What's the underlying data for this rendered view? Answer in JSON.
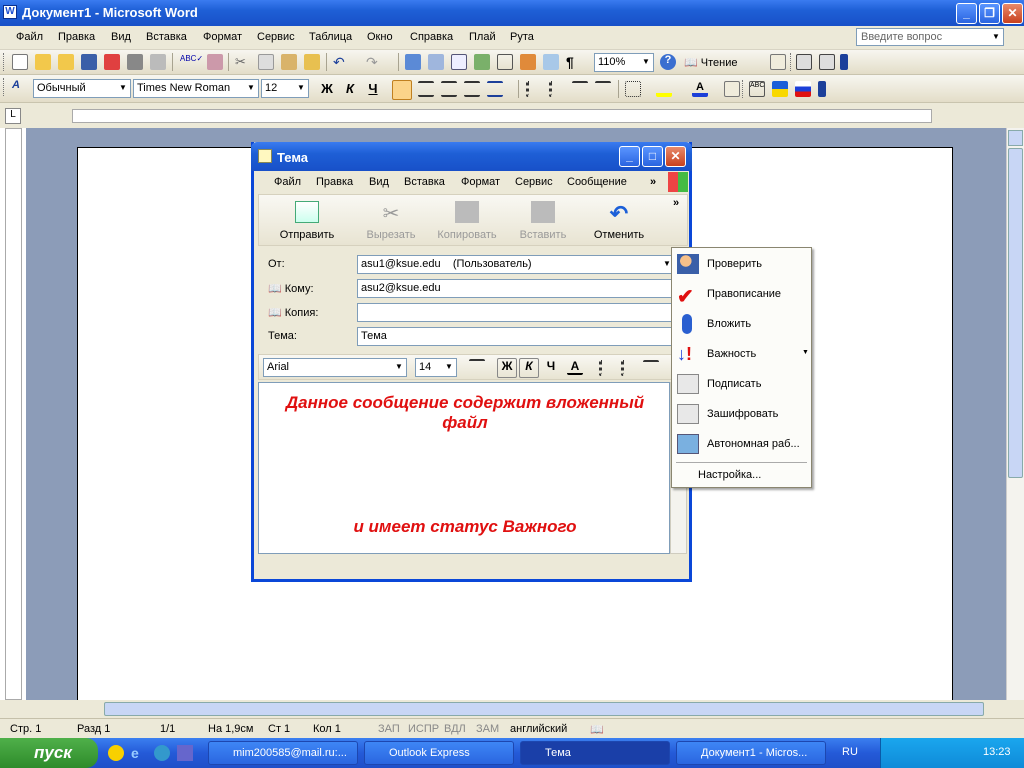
{
  "word": {
    "title": "Документ1 - Microsoft Word",
    "menu": [
      "Файл",
      "Правка",
      "Вид",
      "Вставка",
      "Формат",
      "Сервис",
      "Таблица",
      "Окно",
      "Справка",
      "Плай",
      "Рута"
    ],
    "help_placeholder": "Введите вопрос",
    "zoom": "110%",
    "read_label": "Чтение",
    "style": "Обычный",
    "font": "Times New Roman",
    "size": "12",
    "bold": "Ж",
    "italic": "К",
    "underline": "Ч"
  },
  "status": {
    "page": "Стр. 1",
    "section": "Разд 1",
    "pages": "1/1",
    "pos": "На 1,9см",
    "line": "Ст 1",
    "col": "Кол 1",
    "rec": "ЗАП",
    "trk": "ИСПР",
    "ext": "ВДЛ",
    "ovr": "ЗАМ",
    "lang": "английский"
  },
  "taskbar": {
    "start": "пуск",
    "tasks": [
      "mim200585@mail.ru:...",
      "Outlook Express",
      "Тема",
      "Документ1 - Micros..."
    ],
    "lang": "RU",
    "clock": "13:23"
  },
  "oe": {
    "title": "Тема",
    "menu": [
      "Файл",
      "Правка",
      "Вид",
      "Вставка",
      "Формат",
      "Сервис",
      "Сообщение"
    ],
    "tools": [
      "Отправить",
      "Вырезать",
      "Копировать",
      "Вставить",
      "Отменить"
    ],
    "from_label": "От:",
    "from_value": "asu1@ksue.edu    (Пользователь)",
    "to_label": "Кому:",
    "to_value": "asu2@ksue.edu",
    "cc_label": "Копия:",
    "cc_value": "",
    "subj_label": "Тема:",
    "subj_value": "Тема",
    "font": "Arial",
    "size": "14",
    "bold": "Ж",
    "italic": "К",
    "underline": "Ч",
    "color": "А",
    "body_line1": "Данное сообщение содержит вложенный",
    "body_line2": "файл",
    "body_line3": "и имеет статус Важного"
  },
  "popup": {
    "items": [
      "Проверить",
      "Правописание",
      "Вложить",
      "Важность",
      "Подписать",
      "Зашифровать",
      "Автономная раб...",
      "Настройка..."
    ]
  }
}
